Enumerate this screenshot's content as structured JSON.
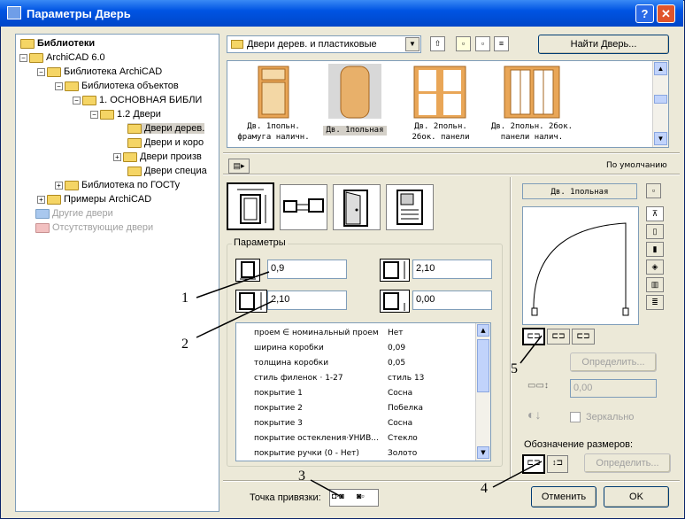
{
  "window": {
    "title": "Параметры Дверь",
    "help_label": "?",
    "close_label": "✕"
  },
  "tree": {
    "items": [
      {
        "label": "Библиотеки",
        "bold": true
      },
      {
        "label": "ArchiCAD 6.0"
      },
      {
        "label": "Библиотека ArchiCAD"
      },
      {
        "label": "Библиотека объектов"
      },
      {
        "label": "1. ОСНОВНАЯ БИБЛИ"
      },
      {
        "label": "1.2 Двери"
      },
      {
        "label": "Двери дерев."
      },
      {
        "label": "Двери и коро"
      },
      {
        "label": "Двери произв"
      },
      {
        "label": "Двери специа"
      },
      {
        "label": "Библиотека по ГОСТу"
      },
      {
        "label": "Примеры ArchiCAD"
      },
      {
        "label": "Другие двери",
        "disabled": true
      },
      {
        "label": "Отсутствующие двери",
        "disabled": true
      }
    ]
  },
  "library": {
    "folder_select": "Двери дерев. и пластиковые",
    "find_button": "Найти Дверь..."
  },
  "thumbnails": [
    {
      "line1": "Дв. 1польн.",
      "line2": "фрамуга наличн."
    },
    {
      "line1": "Дв. 1польная",
      "line2": ""
    },
    {
      "line1": "Дв. 2польн.",
      "line2": "2бок. панели"
    },
    {
      "line1": "Дв. 2польн. 2бок.",
      "line2": "панели налич."
    }
  ],
  "default_label": "По умолчанию",
  "params": {
    "group_title": "Параметры",
    "width": "0,9",
    "height": "2,10",
    "sill_height": "2,10",
    "elevation": "0,00",
    "rows": [
      {
        "name": "проем ∈ номинальный проем",
        "value": "Нет"
      },
      {
        "name": "ширина коробки",
        "value": "0,09"
      },
      {
        "name": "толщина коробки",
        "value": "0,05"
      },
      {
        "name": "стиль филенок · 1-27",
        "value": "стиль 13"
      },
      {
        "name": "покрытие 1",
        "value": "Сосна"
      },
      {
        "name": "покрытие 2",
        "value": "Побелка"
      },
      {
        "name": "покрытие 3",
        "value": "Сосна"
      },
      {
        "name": "покрытие остекления·УНИВ...",
        "value": "Стекло"
      },
      {
        "name": "покрытие ручки (0 - Нет)",
        "value": "Золото"
      }
    ]
  },
  "preview": {
    "name": "Дв. 1польная"
  },
  "right": {
    "define_button": "Определить...",
    "offset_value": "0,00",
    "mirror_label": "Зеркально",
    "dim_label": "Обозначение размеров:",
    "dim_define_button": "Определить..."
  },
  "anchor_label": "Точка привязки:",
  "buttons": {
    "cancel": "Отменить",
    "ok": "OK"
  },
  "callouts": [
    "1",
    "2",
    "3",
    "4",
    "5"
  ]
}
